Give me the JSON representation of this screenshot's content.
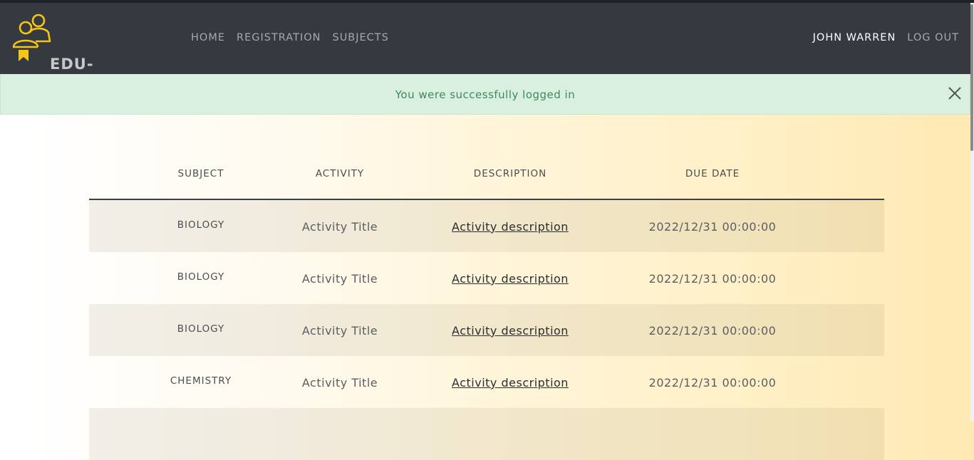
{
  "brand": {
    "name": "EDU-BOARD",
    "icon": "users-badge-icon",
    "accent": "#f5c518"
  },
  "nav": {
    "links": [
      "HOME",
      "REGISTRATION",
      "SUBJECTS"
    ],
    "user": "JOHN WARREN",
    "logout": "LOG OUT"
  },
  "alert": {
    "message": "You were successfully logged in",
    "close_icon": "close-icon"
  },
  "table": {
    "headers": [
      "SUBJECT",
      "ACTIVITY",
      "DESCRIPTION",
      "DUE DATE"
    ],
    "rows": [
      {
        "subject": "BIOLOGY",
        "activity": "Activity Title",
        "description": "Activity description",
        "due": "2022/12/31 00:00:00"
      },
      {
        "subject": "BIOLOGY",
        "activity": "Activity Title",
        "description": "Activity description",
        "due": "2022/12/31 00:00:00"
      },
      {
        "subject": "BIOLOGY",
        "activity": "Activity Title",
        "description": "Activity description",
        "due": "2022/12/31 00:00:00"
      },
      {
        "subject": "CHEMISTRY",
        "activity": "Activity Title",
        "description": "Activity description",
        "due": "2022/12/31 00:00:00"
      },
      {
        "subject": "",
        "activity": "",
        "description": "",
        "due": ""
      }
    ]
  }
}
